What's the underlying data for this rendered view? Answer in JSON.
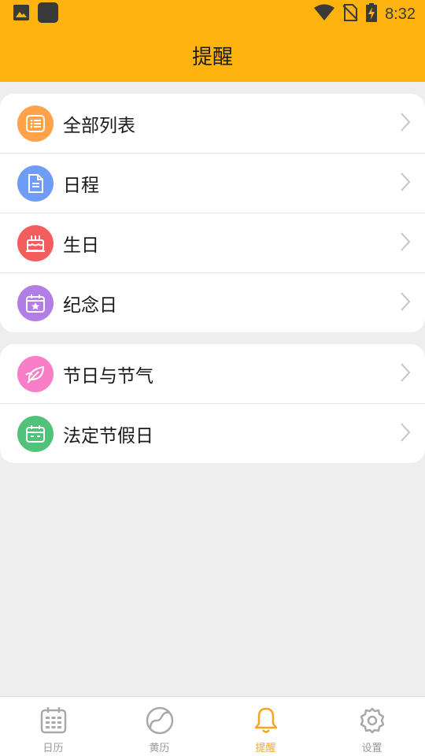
{
  "status_bar": {
    "time": "8:32",
    "icons": [
      "image-icon",
      "app-icon",
      "wifi-icon",
      "no-sim-icon",
      "battery-charging-icon"
    ]
  },
  "header": {
    "title": "提醒"
  },
  "colors": {
    "accent": "#ffb30e",
    "all_list": "#ffa24a",
    "schedule": "#6f9cf4",
    "birthday": "#f45d5d",
    "anniversary": "#b27ee6",
    "festival": "#f97ec7",
    "holiday": "#52c27a",
    "tab_active": "#f5a623",
    "tab_inactive": "#9a9a9a"
  },
  "groups": [
    {
      "items": [
        {
          "label": "全部列表",
          "icon": "list-icon"
        },
        {
          "label": "日程",
          "icon": "document-icon"
        },
        {
          "label": "生日",
          "icon": "cake-icon"
        },
        {
          "label": "纪念日",
          "icon": "calendar-star-icon"
        }
      ]
    },
    {
      "items": [
        {
          "label": "节日与节气",
          "icon": "leaf-icon"
        },
        {
          "label": "法定节假日",
          "icon": "calendar-icon"
        }
      ]
    }
  ],
  "tabs": [
    {
      "label": "日历",
      "icon": "calendar-icon",
      "active": false
    },
    {
      "label": "黄历",
      "icon": "yin-yang-icon",
      "active": false
    },
    {
      "label": "提醒",
      "icon": "bell-icon",
      "active": true
    },
    {
      "label": "设置",
      "icon": "gear-icon",
      "active": false
    }
  ]
}
